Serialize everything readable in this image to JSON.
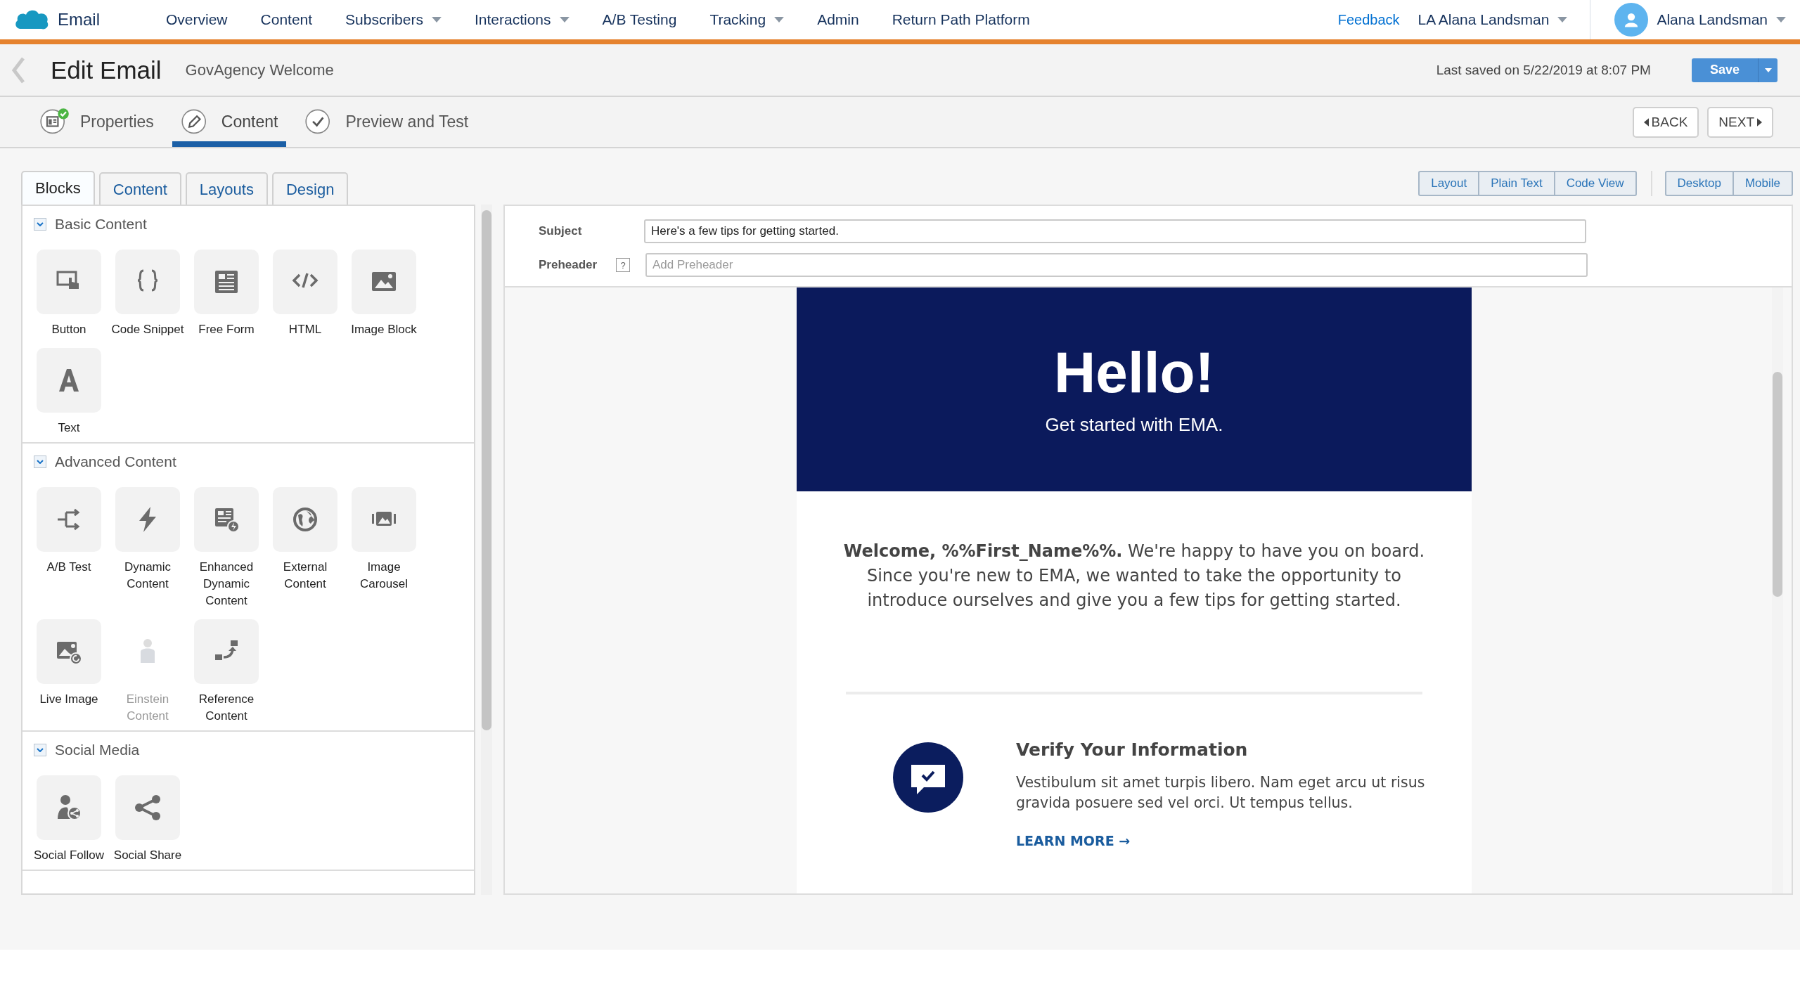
{
  "nav": {
    "app": "Email",
    "items": [
      {
        "label": "Overview",
        "dropdown": false
      },
      {
        "label": "Content",
        "dropdown": false
      },
      {
        "label": "Subscribers",
        "dropdown": true
      },
      {
        "label": "Interactions",
        "dropdown": true
      },
      {
        "label": "A/B Testing",
        "dropdown": false
      },
      {
        "label": "Tracking",
        "dropdown": true
      },
      {
        "label": "Admin",
        "dropdown": false
      },
      {
        "label": "Return Path Platform",
        "dropdown": false
      }
    ],
    "feedback": "Feedback",
    "account": "LA Alana Landsman",
    "user": "Alana Landsman"
  },
  "header": {
    "title": "Edit Email",
    "email_name": "GovAgency Welcome",
    "last_saved": "Last saved on 5/22/2019 at 8:07 PM",
    "save": "Save"
  },
  "steps": [
    {
      "label": "Properties",
      "kind": "properties",
      "selected": false,
      "completed": true
    },
    {
      "label": "Content",
      "kind": "content",
      "selected": true,
      "completed": false
    },
    {
      "label": "Preview and Test",
      "kind": "preview",
      "selected": false,
      "completed": false
    }
  ],
  "step_buttons": {
    "back": "BACK",
    "next": "NEXT"
  },
  "panel_tabs": [
    {
      "label": "Blocks",
      "selected": true
    },
    {
      "label": "Content",
      "selected": false
    },
    {
      "label": "Layouts",
      "selected": false
    },
    {
      "label": "Design",
      "selected": false
    }
  ],
  "sections": [
    {
      "title": "Basic Content",
      "expanded": true,
      "blocks": [
        {
          "label": "Button",
          "kind": "button",
          "disabled": false
        },
        {
          "label": "Code Snippet",
          "kind": "braces",
          "disabled": false
        },
        {
          "label": "Free Form",
          "kind": "freeform",
          "disabled": false
        },
        {
          "label": "HTML",
          "kind": "code",
          "disabled": false
        },
        {
          "label": "Image Block",
          "kind": "image",
          "disabled": false
        },
        {
          "label": "Text",
          "kind": "text",
          "disabled": false
        }
      ]
    },
    {
      "title": "Advanced Content",
      "expanded": true,
      "blocks": [
        {
          "label": "A/B Test",
          "kind": "split",
          "disabled": false
        },
        {
          "label": "Dynamic Content",
          "kind": "bolt",
          "disabled": false
        },
        {
          "label": "Enhanced Dynamic Content",
          "kind": "enhanced",
          "disabled": false
        },
        {
          "label": "External Content",
          "kind": "globe",
          "disabled": false
        },
        {
          "label": "Image Carousel",
          "kind": "carousel",
          "disabled": false
        },
        {
          "label": "Live Image",
          "kind": "liveimage",
          "disabled": false
        },
        {
          "label": "Einstein Content",
          "kind": "figure",
          "disabled": true
        },
        {
          "label": "Reference Content",
          "kind": "reference",
          "disabled": false
        }
      ]
    },
    {
      "title": "Social Media",
      "expanded": true,
      "blocks": [
        {
          "label": "Social Follow",
          "kind": "follow",
          "disabled": false
        },
        {
          "label": "Social Share",
          "kind": "share",
          "disabled": false
        }
      ]
    }
  ],
  "view_modes": [
    "Layout",
    "Plain Text",
    "Code View"
  ],
  "devices": [
    "Desktop",
    "Mobile"
  ],
  "subject": {
    "label": "Subject",
    "value": "Here's a few tips for getting started."
  },
  "preheader": {
    "label": "Preheader",
    "help": "?",
    "placeholder": "Add Preheader"
  },
  "email": {
    "hero_title": "Hello!",
    "hero_subtitle": "Get started with EMA.",
    "intro": "**Welcome, %%First_Name%%.** We're happy to have you on board. Since you're new to EMA, we wanted to take the opportunity to introduce ourselves and give you a few tips for getting started.",
    "feature_title": "Verify Your Information",
    "feature_text": "Vestibulum sit amet turpis libero. Nam eget arcu ut risus gravida posuere sed vel orci. Ut tempus tellus.",
    "feature_link": "LEARN MORE →"
  }
}
